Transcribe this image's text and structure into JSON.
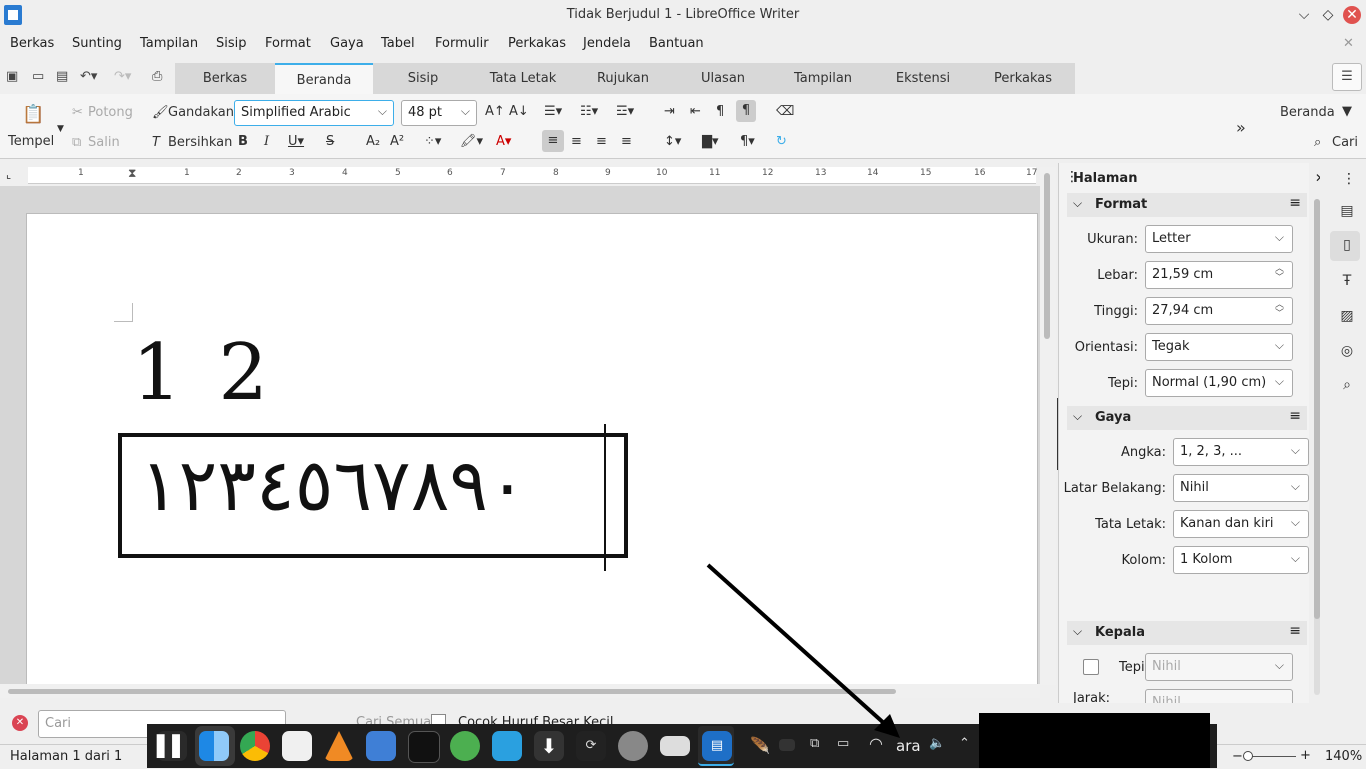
{
  "window": {
    "title": "Tidak Berjudul 1 - LibreOffice Writer"
  },
  "menu": [
    "Berkas",
    "Sunting",
    "Tampilan",
    "Sisip",
    "Format",
    "Gaya",
    "Tabel",
    "Formulir",
    "Perkakas",
    "Jendela",
    "Bantuan"
  ],
  "tabs": [
    "Berkas",
    "Beranda",
    "Sisip",
    "Tata Letak",
    "Rujukan",
    "Ulasan",
    "Tampilan",
    "Ekstensi",
    "Perkakas"
  ],
  "toolbar": {
    "paste": "Tempel",
    "cut": "Potong",
    "copy": "Salin",
    "clone": "Gandakan",
    "clear": "Bersihkan",
    "font_name": "Simplified Arabic",
    "font_size": "48 pt",
    "context": "Beranda",
    "find": "Cari"
  },
  "document": {
    "line1": "1 2",
    "arabic_digits": "١٢٣٤٥٦٧٨٩٠"
  },
  "ruler": [
    "1",
    "1",
    "2",
    "3",
    "4",
    "5",
    "6",
    "7",
    "8",
    "9",
    "10",
    "11",
    "12",
    "13",
    "14",
    "15",
    "16",
    "17"
  ],
  "sidebar": {
    "title": "Halaman",
    "format": {
      "title": "Format",
      "size_label": "Ukuran:",
      "size": "Letter",
      "width_label": "Lebar:",
      "width": "21,59 cm",
      "height_label": "Tinggi:",
      "height": "27,94 cm",
      "orient_label": "Orientasi:",
      "orient": "Tegak",
      "margin_label": "Tepi:",
      "margin": "Normal (1,90 cm)"
    },
    "styles": {
      "title": "Gaya",
      "number_label": "Angka:",
      "number": "1, 2, 3, ...",
      "bg_label": "Latar Belakang:",
      "bg": "Nihil",
      "layout_label": "Tata Letak:",
      "layout": "Kanan dan kiri",
      "columns_label": "Kolom:",
      "columns": "1 Kolom"
    },
    "header": {
      "title": "Kepala",
      "margin_label": "Tepi:",
      "margin": "Nihil",
      "spacing_label": "Jarak:",
      "spacing": "Nihil"
    }
  },
  "findbar": {
    "placeholder": "Cari",
    "find_all": "Cari Semua",
    "match_case": "Cocok Huruf Besar Kecil"
  },
  "status": {
    "page": "Halaman 1 dari 1",
    "zoom": "140%"
  },
  "tray": {
    "lang": "ara"
  }
}
